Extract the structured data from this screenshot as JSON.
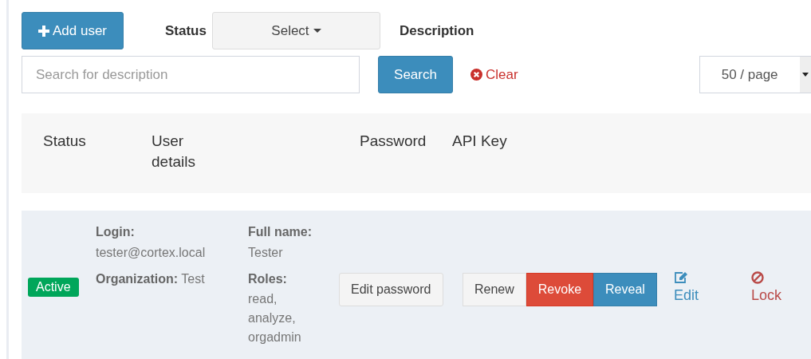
{
  "toolbar": {
    "add_button": "Add user",
    "status_label": "Status",
    "status_select": "Select",
    "description_label": "Description",
    "search": {
      "placeholder": "Search for description"
    },
    "search_button": "Search",
    "clear_link": "Clear",
    "page_size": "50 / page"
  },
  "table": {
    "columns": [
      "Status",
      "User details",
      "Password",
      "API Key"
    ],
    "rows": [
      {
        "status": {
          "label": "Active",
          "kind": "active"
        },
        "login_label": "Login:",
        "login": "tester@cortex.local",
        "org_label": "Organization:",
        "org": "Test",
        "fullname_label": "Full name:",
        "fullname": "Tester",
        "roles_label": "Roles:",
        "roles": [
          "read,",
          "analyze,",
          "orgadmin"
        ],
        "password_button": "Edit password",
        "key_buttons": [
          {
            "label": "Renew",
            "kind": "default"
          },
          {
            "label": "Revoke",
            "kind": "danger"
          },
          {
            "label": "Reveal",
            "kind": "primary"
          }
        ],
        "edit": "Edit",
        "lock": "Lock"
      }
    ]
  }
}
